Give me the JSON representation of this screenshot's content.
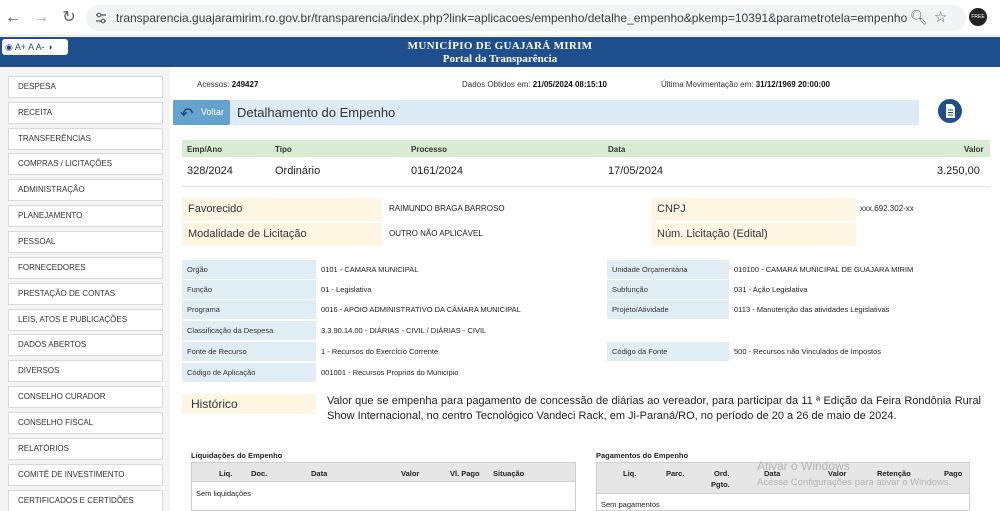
{
  "browser": {
    "url": "transparencia.guajaramirim.ro.gov.br/transparencia/index.php?link=aplicacoes/empenho/detalhe_empenho&pkemp=10391&parametrotela=empenho",
    "profile_label": "FREE PROTECTION"
  },
  "header": {
    "title": "MUNICÍPIO DE GUAJARÁ MIRIM",
    "subtitle": "Portal da Transparência",
    "accessibility": "A+ A A-"
  },
  "sidebar": {
    "items": [
      {
        "label": "DESPESA"
      },
      {
        "label": "RECEITA"
      },
      {
        "label": "TRANSFERÊNCIAS"
      },
      {
        "label": "COMPRAS / LICITAÇÕES"
      },
      {
        "label": "ADMINISTRAÇÃO"
      },
      {
        "label": "PLANEJAMENTO"
      },
      {
        "label": "PESSOAL"
      },
      {
        "label": "FORNECEDORES"
      },
      {
        "label": "PRESTAÇÃO DE CONTAS"
      },
      {
        "label": "LEIS, ATOS E PUBLICAÇÕES"
      },
      {
        "label": "DADOS ABERTOS"
      },
      {
        "label": "DIVERSOS"
      },
      {
        "label": "CONSELHO CURADOR"
      },
      {
        "label": "CONSELHO FISCAL"
      },
      {
        "label": "RELATÓRIOS"
      },
      {
        "label": "COMITÊ DE INVESTIMENTO"
      },
      {
        "label": "CERTIFICADOS E CERTIDÕES"
      }
    ]
  },
  "info": {
    "acessos_label": "Acessos:",
    "acessos_value": "249427",
    "obtidos_label": "Dados Obtidos em:",
    "obtidos_value": "21/05/2024 08:15:10",
    "movimentacao_label": "Última Movimentação em:",
    "movimentacao_value": "31/12/1969 20:00:00"
  },
  "page": {
    "back_label": "Voltar",
    "title": "Detalhamento do Empenho"
  },
  "summary": {
    "headers": [
      "Emp/Ano",
      "Tipo",
      "Processo",
      "Data",
      "Valor"
    ],
    "values": [
      "328/2024",
      "Ordinário",
      "0161/2024",
      "17/05/2024",
      "3.250,00"
    ]
  },
  "favorecido": {
    "favorecido_label": "Favorecido",
    "favorecido_value": "RAIMUNDO BRAGA BARROSO",
    "cnpj_label": "CNPJ",
    "cnpj_value": "xxx.692.302-xx",
    "modalidade_label": "Modalidade de Licitação",
    "modalidade_value": "OUTRO NÃO APLICÁVEL",
    "num_licitacao_label": "Núm. Licitação (Edital)",
    "num_licitacao_value": ""
  },
  "classificacao": {
    "orgao_label": "Orgão",
    "orgao_value": "0101 - CAMARA MUNICIPAL",
    "unidade_label": "Unidade Orçamentária",
    "unidade_value": "010100 - CAMARA MUNICIPAL DE GUAJARA MIRIM",
    "funcao_label": "Função",
    "funcao_value": "01 - Legislativa",
    "subfuncao_label": "Subfunção",
    "subfuncao_value": "031 - Ação Legislativa",
    "programa_label": "Programa",
    "programa_value": "0016 - APOIO ADMINISTRATIVO DA CÂMARA MUNICIPAL",
    "projeto_label": "Projeto/Atividade",
    "projeto_value": "0113 - Manutenção das atividades Legislativas",
    "classif_label": "Classificação da Despesa",
    "classif_value": "3.3.90.14.00 - DIÁRIAS - CIVIL / DIÁRIAS - CIVIL",
    "fonte_label": "Fonte de Recurso",
    "fonte_value": "1 - Recursos do Exercício Corrente",
    "cod_fonte_label": "Código da Fonte",
    "cod_fonte_value": "500 - Recursos não Vinculados de Impostos",
    "cod_aplic_label": "Código de Aplicação",
    "cod_aplic_value": "001001 - Recursos Proprios do Municipio"
  },
  "historico": {
    "label": "Histórico",
    "text": "Valor que se empenha para pagamento de concessão de diárias ao vereador, para participar da 11 ª Edição da Feira Rondônia Rural Show Internacional, no centro Tecnológico Vandeci Rack, em Ji-Paraná/RO, no período de 20 a 26 de maio de 2024."
  },
  "liquidacoes": {
    "title": "Liquidações do Empenho",
    "headers": [
      "Liq.",
      "Doc.",
      "Data",
      "Valor",
      "Vl. Pago",
      "Situação"
    ],
    "empty": "Sem liquidações"
  },
  "pagamentos": {
    "title": "Pagamentos do Empenho",
    "headers": [
      "Liq.",
      "Parc.",
      "Ord.",
      "Pgto.",
      "Data",
      "Valor",
      "Retenção",
      "Pago"
    ],
    "empty": "Sem pagamentos"
  },
  "watermark": {
    "line1": "Ativar o Windows",
    "line2": "Acesse Configurações para ativar o Windows."
  },
  "colors": {
    "banner": "#1f4e8c",
    "title_bar": "#dcebf5",
    "back_button": "#64a2d0",
    "summary_header": "#d8ecd1",
    "label_bg_yellow": "#fdf6e3",
    "label_bg_blue": "#e1edf5"
  }
}
